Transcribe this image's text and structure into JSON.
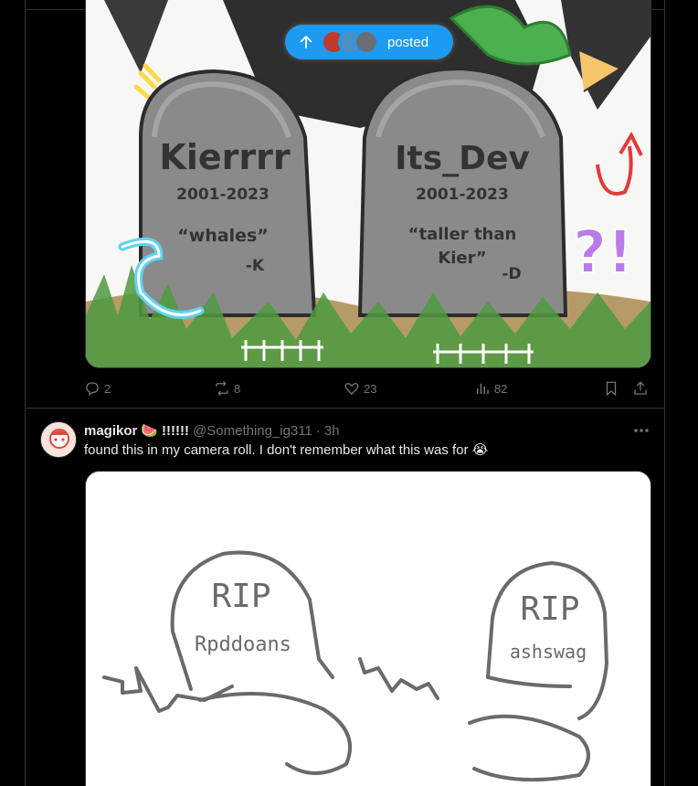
{
  "post1": {
    "image_alt": "Cartoon drawing of two gravestones",
    "stones": [
      {
        "name": "Kierrrr",
        "years": "2001-2023",
        "quote": "“whales”",
        "sign": "-K"
      },
      {
        "name": "Its_Dev",
        "years": "2001-2023",
        "quote_line1": "“taller than",
        "quote_line2": "Kier”",
        "sign": "-D"
      }
    ],
    "doodle_text": "?!",
    "actions": {
      "replies": "2",
      "reposts": "8",
      "likes": "23",
      "views": "82"
    }
  },
  "new_posts_pill": {
    "label": "posted",
    "avatar_colors": [
      "#c0392b",
      "#4a90c2",
      "#6b6f75"
    ]
  },
  "post2": {
    "display_name": "magikor",
    "name_emoji": "🍉",
    "name_suffix": "!!!!!!",
    "handle": "@Something_ig311",
    "separator": "·",
    "time": "3h",
    "text": "found this in my camera roll. I don't remember what this was for 😭",
    "sketch": {
      "left_top": "RIP",
      "left_bottom": "Rpddoans",
      "right_top": "RIP",
      "right_bottom": "ashswag"
    }
  },
  "colors": {
    "accent": "#1d9bf0",
    "muted": "#71767b",
    "border": "#2f3336"
  }
}
